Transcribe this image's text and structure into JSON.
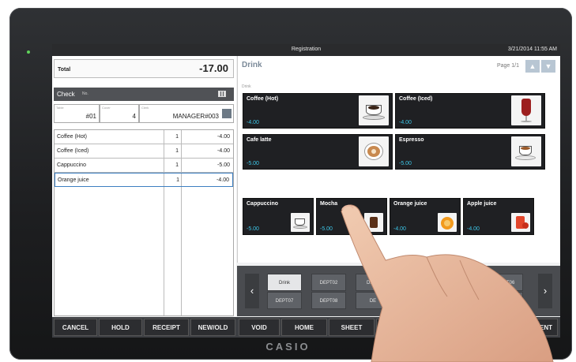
{
  "window": {
    "title": "Registration",
    "datetime": "3/21/2014 11:55 AM"
  },
  "brand": "CASIO",
  "order": {
    "total_label": "Total",
    "total_value": "-17.00",
    "check_label": "Check",
    "check_no_caption": "No.",
    "table_caption": "Table",
    "table_value": "#01",
    "cover_caption": "Cover",
    "cover_value": "4",
    "clerk_caption": "Clerk",
    "clerk_value": "MANAGER#003",
    "items": [
      {
        "name": "Coffee (Hot)",
        "qty": "1",
        "price": "-4.00"
      },
      {
        "name": "Coffee (Iced)",
        "qty": "1",
        "price": "-4.00"
      },
      {
        "name": "Cappuccino",
        "qty": "1",
        "price": "-5.00"
      },
      {
        "name": "Orange juice",
        "qty": "1",
        "price": "-4.00"
      }
    ]
  },
  "menu": {
    "category_title": "Drink",
    "category_sub": "Drink",
    "page_indicator": "Page 1/1",
    "page_up_icon": "chevron-up-icon",
    "page_down_icon": "chevron-down-icon",
    "large_tiles": [
      {
        "label": "Coffee (Hot)",
        "price": "-4.00",
        "icon": "hot-coffee-cup-icon"
      },
      {
        "label": "Coffee (Iced)",
        "price": "-4.00",
        "icon": "iced-coffee-glass-icon"
      },
      {
        "label": "Cafe latte",
        "price": "-5.00",
        "icon": "latte-cup-icon"
      },
      {
        "label": "Espresso",
        "price": "-5.00",
        "icon": "espresso-cup-icon"
      }
    ],
    "small_tiles": [
      {
        "label": "Cappuccino",
        "price": "-5.00",
        "icon": "cappuccino-cup-icon"
      },
      {
        "label": "Mocha",
        "price": "-5.00",
        "icon": "mocha-cup-icon"
      },
      {
        "label": "Orange juice",
        "price": "-4.00",
        "icon": "orange-icon"
      },
      {
        "label": "Apple juice",
        "price": "-4.00",
        "icon": "apple-juice-icon"
      }
    ]
  },
  "departments": {
    "row1": [
      "Drink",
      "DEPT02",
      "DEPT",
      "",
      "DEPT05",
      "DEPT06"
    ],
    "row2": [
      "DEPT07",
      "DEPT08",
      "DE",
      "",
      "",
      "T2"
    ],
    "left_icon": "chevron-left-icon",
    "right_icon": "chevron-right-icon"
  },
  "functions": [
    "CANCEL",
    "HOLD",
    "RECEIPT",
    "NEW/OLD",
    "VOID",
    "HOME",
    "SHEET",
    "",
    "",
    "YMENT"
  ],
  "colors": {
    "price_accent": "#3cc6e8",
    "selected_row_border": "#3d7fc1",
    "tile_bg": "#1f2023"
  }
}
